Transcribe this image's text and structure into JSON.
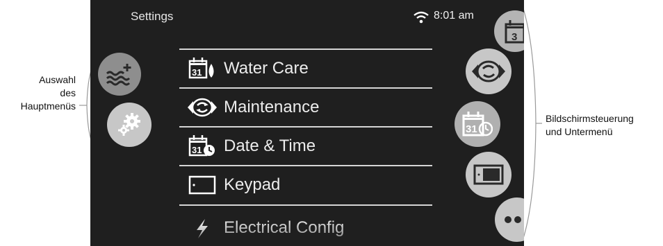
{
  "annotations": {
    "left_lines": [
      "Auswahl",
      "des",
      "Hauptmenüs"
    ],
    "right_lines": [
      "Bildschirmsteuerung",
      "und Untermenü"
    ]
  },
  "topbar": {
    "title": "Settings",
    "time": "8:01 am",
    "wifi_icon": "wifi-icon"
  },
  "main_menu": [
    {
      "icon": "water-add-icon"
    },
    {
      "icon": "gears-icon"
    }
  ],
  "settings_list": [
    {
      "label": "Water Care",
      "icon": "calendar-drop-icon"
    },
    {
      "label": "Maintenance",
      "icon": "cycle-arrows-icon"
    },
    {
      "label": "Date & Time",
      "icon": "calendar-clock-icon"
    },
    {
      "label": "Keypad",
      "icon": "keypad-icon"
    },
    {
      "label": "Electrical Config",
      "icon": "electrical-icon"
    }
  ],
  "control_buttons": [
    {
      "icon": "calendar-icon",
      "label": "3"
    },
    {
      "icon": "cycle-arrows-icon"
    },
    {
      "icon": "calendar-clock-icon",
      "label": "31"
    },
    {
      "icon": "keypad-icon"
    },
    {
      "icon": "more-icon"
    }
  ],
  "colors": {
    "screen_bg": "#1f1f1f",
    "button_bg": "#c7c7c7",
    "divider": "#d6d6d6",
    "text": "#ececec"
  }
}
